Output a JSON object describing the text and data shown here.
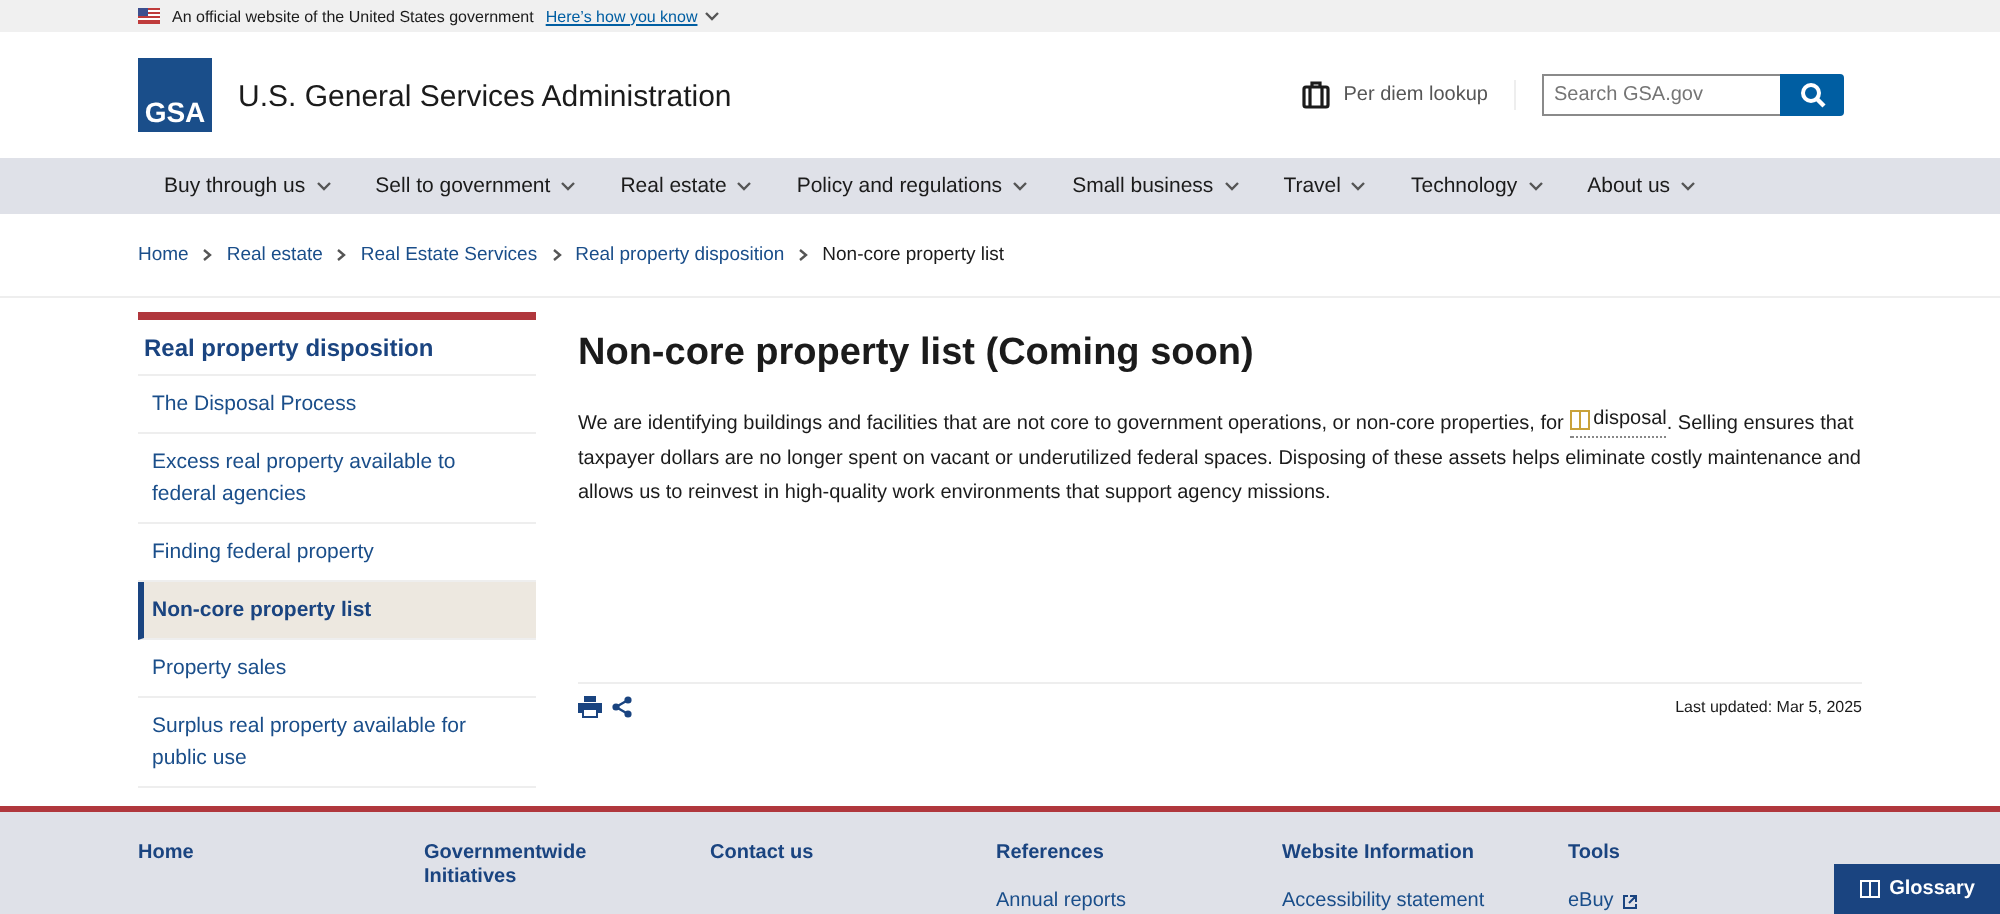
{
  "banner": {
    "text": "An official website of the United States government",
    "link": "Here’s how you know"
  },
  "header": {
    "logo": "GSA",
    "agency": "U.S. General Services Administration",
    "per_diem": "Per diem lookup",
    "search": {
      "placeholder": "Search GSA.gov"
    }
  },
  "nav": [
    "Buy through us",
    "Sell to government",
    "Real estate",
    "Policy and regulations",
    "Small business",
    "Travel",
    "Technology",
    "About us"
  ],
  "breadcrumb": [
    {
      "label": "Home",
      "current": false
    },
    {
      "label": "Real estate",
      "current": false
    },
    {
      "label": "Real Estate Services",
      "current": false
    },
    {
      "label": "Real property disposition",
      "current": false
    },
    {
      "label": "Non-core property list",
      "current": true
    }
  ],
  "sidebar": {
    "title": "Real property disposition",
    "items": [
      {
        "label": "The Disposal Process",
        "selected": false
      },
      {
        "label": "Excess real property available to federal agencies",
        "selected": false
      },
      {
        "label": "Finding federal property",
        "selected": false
      },
      {
        "label": "Non-core property list",
        "selected": true
      },
      {
        "label": "Property sales",
        "selected": false
      },
      {
        "label": "Surplus real property available for public use",
        "selected": false
      }
    ]
  },
  "main": {
    "title": "Non-core property list (Coming soon)",
    "paragraph": {
      "before": "We are identifying buildings and facilities that are not core to government operations, or non-core properties, for ",
      "term": "disposal",
      "after": ". Selling ensures that taxpayer dollars are no longer spent on vacant or underutilized federal spaces. Disposing of these assets helps eliminate costly maintenance and allows us to reinvest in high-quality work environments that support agency missions."
    },
    "last_updated": "Last updated: Mar 5, 2025"
  },
  "footer": [
    {
      "heading": "Home"
    },
    {
      "heading": "Governmentwide Initiatives"
    },
    {
      "heading": "Contact us"
    },
    {
      "heading": "References",
      "links": [
        "Annual reports"
      ]
    },
    {
      "heading": "Website Information",
      "links": [
        "Accessibility statement"
      ]
    },
    {
      "heading": "Tools",
      "links": [
        {
          "label": "eBuy",
          "external": true
        }
      ]
    }
  ],
  "glossary_button": "Glossary"
}
